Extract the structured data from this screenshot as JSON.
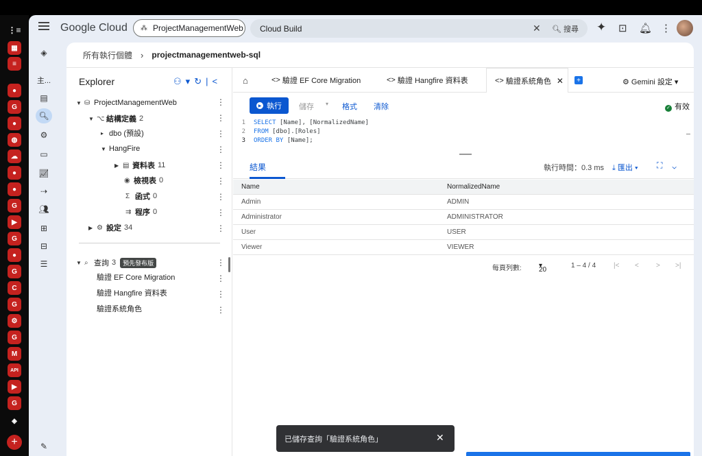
{
  "header": {
    "logo": "Google Cloud",
    "project": "ProjectManagementWeb",
    "search_value": "Cloud Build",
    "search_button": "搜尋"
  },
  "breadcrumb": {
    "parent": "所有執行個體",
    "current": "projectmanagementweb-sql"
  },
  "rail": {
    "main_label": "主..."
  },
  "explorer": {
    "title": "Explorer",
    "root": "ProjectManagementWeb",
    "schema": "結構定義",
    "schema_count": "2",
    "dbo": "dbo (預設)",
    "hangfire": "HangFire",
    "tables": "資料表",
    "tables_count": "11",
    "views": "檢視表",
    "views_count": "0",
    "functions": "函式",
    "functions_count": "0",
    "procedures": "程序",
    "procedures_count": "0",
    "settings": "設定",
    "settings_count": "34",
    "queries": "查詢",
    "queries_count": "3",
    "preview_badge": "預先發布版",
    "query_items": [
      "驗證 EF Core Migration",
      "驗證 Hangfire 資料表",
      "驗證系統角色"
    ]
  },
  "tabs": {
    "items": [
      "驗證 EF Core Migration",
      "驗證 Hangfire 資料表",
      "驗證系統角色"
    ],
    "gemini": "Gemini 設定"
  },
  "toolbar": {
    "run": "執行",
    "save": "儲存",
    "format": "格式",
    "clear": "清除",
    "status": "有效"
  },
  "code": [
    {
      "ln": "1",
      "kw": "SELECT",
      "rest": " [Name], [NormalizedName]"
    },
    {
      "ln": "2",
      "kw": "FROM",
      "rest": " [dbo].[Roles]"
    },
    {
      "ln": "3",
      "kw": "ORDER BY",
      "rest": " [Name];"
    }
  ],
  "results": {
    "tab": "結果",
    "exec_time": "執行時間：0.3 ms",
    "export": "匯出",
    "columns": [
      "Name",
      "NormalizedName"
    ],
    "rows": [
      [
        "Admin",
        "ADMIN"
      ],
      [
        "Administrator",
        "ADMINISTRATOR"
      ],
      [
        "User",
        "USER"
      ],
      [
        "Viewer",
        "VIEWER"
      ]
    ],
    "rows_per_page_label": "每頁列數:",
    "rows_per_page": "20",
    "range": "1 – 4 / 4"
  },
  "toast": {
    "message": "已儲存查詢「驗證系統角色」"
  },
  "colors": {
    "accent": "#0b57d0",
    "valid": "#188038",
    "toast_bg": "#303134"
  }
}
